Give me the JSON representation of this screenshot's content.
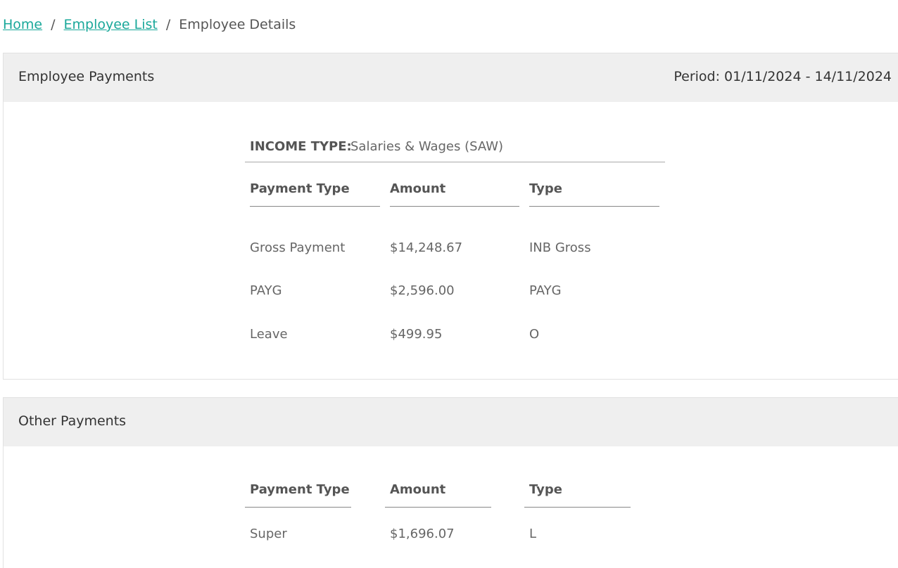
{
  "breadcrumb": {
    "home": "Home",
    "separator_1": "/",
    "employee_list": "Employee List",
    "separator_2": "/",
    "current": "Employee Details"
  },
  "employee_payments": {
    "title": "Employee Payments",
    "period": "Period: 01/11/2024 - 14/11/2024",
    "income_type_label": "INCOME TYPE:",
    "income_type_value": "Salaries & Wages (SAW)",
    "columns": [
      "Payment Type",
      "Amount",
      "Type"
    ],
    "rows": [
      [
        "Gross Payment",
        "$14,248.67",
        "INB Gross"
      ],
      [
        "PAYG",
        "$2,596.00",
        "PAYG"
      ],
      [
        "Leave",
        "$499.95",
        "O"
      ]
    ]
  },
  "other_payments": {
    "title": "Other Payments",
    "columns": [
      "Payment Type",
      "Amount",
      "Type"
    ],
    "rows": [
      [
        "Super",
        "$1,696.07",
        "L"
      ]
    ]
  },
  "colors": {
    "link": "#1aa89a",
    "header_bg": "#efefef",
    "border": "#e2e2e2"
  }
}
